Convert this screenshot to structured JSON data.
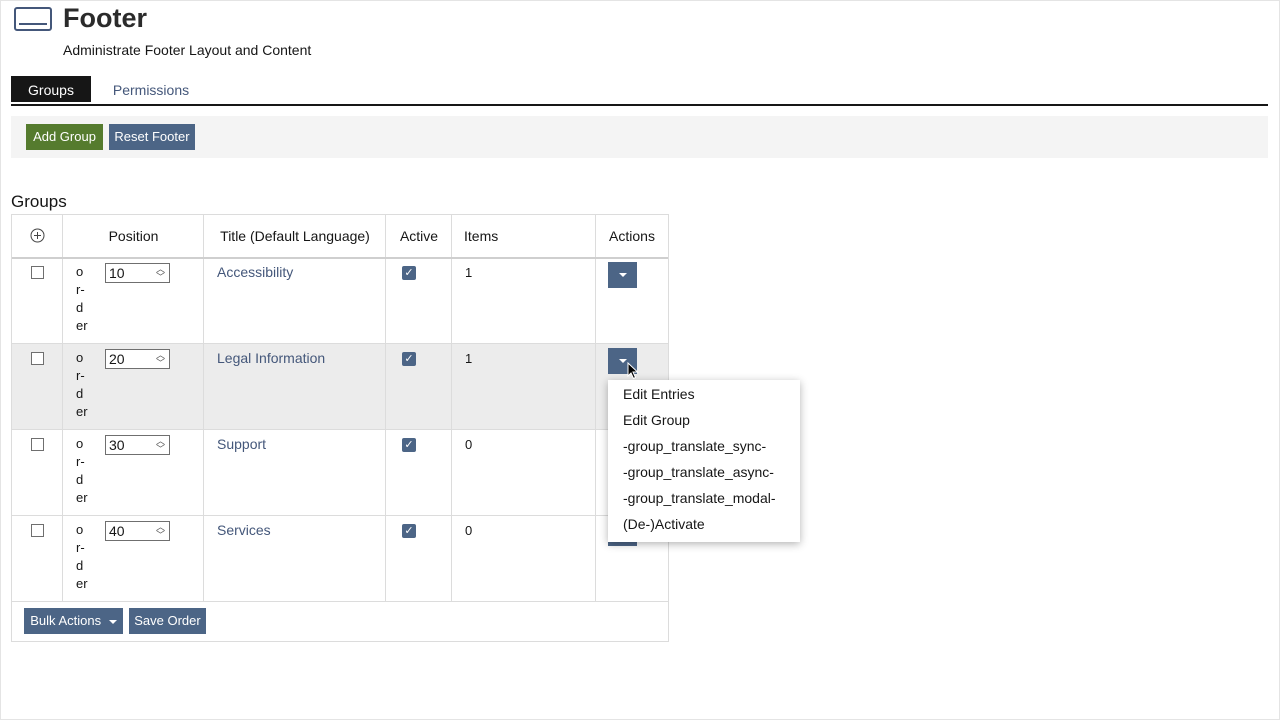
{
  "header": {
    "title": "Footer",
    "description": "Administrate Footer Layout and Content",
    "icon": "footer-layout-icon"
  },
  "tabs": [
    {
      "label": "Groups",
      "active": true
    },
    {
      "label": "Permissions",
      "active": false
    }
  ],
  "toolbar": {
    "add_group_label": "Add Group",
    "reset_footer_label": "Reset Footer"
  },
  "section_title": "Groups",
  "table": {
    "columns": [
      "Position",
      "Title (Default Language)",
      "Active",
      "Items",
      "Actions"
    ],
    "order_label": [
      "o",
      "r-",
      "d",
      "er"
    ],
    "rows": [
      {
        "position": "10",
        "title": "Accessibility",
        "active": true,
        "items": "1"
      },
      {
        "position": "20",
        "title": "Legal Information",
        "active": true,
        "items": "1"
      },
      {
        "position": "30",
        "title": "Support",
        "active": true,
        "items": "0"
      },
      {
        "position": "40",
        "title": "Services",
        "active": true,
        "items": "0"
      }
    ],
    "bulk_actions_label": "Bulk Actions",
    "save_order_label": "Save Order"
  },
  "dropdown": {
    "items": [
      "Edit Entries",
      "Edit Group",
      "-group_translate_sync-",
      "-group_translate_async-",
      "-group_translate_modal-",
      "(De-)Activate"
    ]
  },
  "colors": {
    "primary": "#4c6586",
    "success": "#557b2e",
    "tab_active": "#161616",
    "link": "#44577a"
  }
}
